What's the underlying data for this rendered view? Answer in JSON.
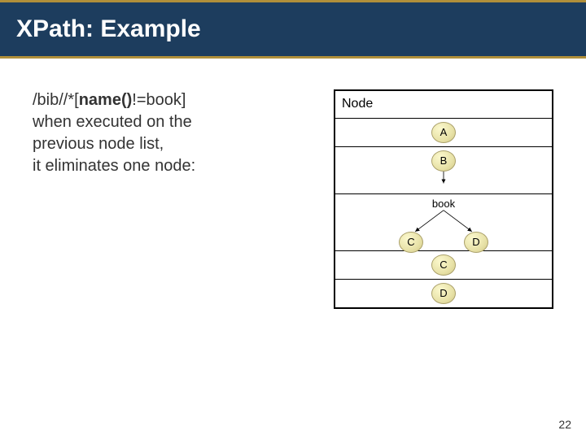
{
  "title": "XPath: Example",
  "xpath": {
    "pre": "/bib//*[",
    "kw": "name()",
    "post": "!=book]"
  },
  "descr": {
    "l1": "when executed on the",
    "l2": "previous node list,",
    "l3": "it eliminates one node:"
  },
  "table": {
    "header": "Node",
    "rowA": "A",
    "rowB": "B",
    "rowBook": "book",
    "rowCD_c": "C",
    "rowCD_d": "D",
    "rowC2": "C",
    "rowD2": "D"
  },
  "page": "22"
}
